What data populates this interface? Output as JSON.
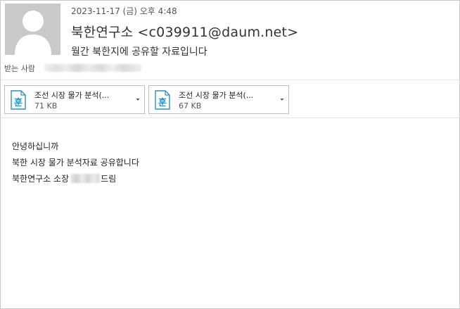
{
  "message": {
    "date": "2023-11-17 (금) 오후 4:48",
    "sender_name": "북한연구소",
    "sender_email": "<c039911@daum.net>",
    "subject": "월간 북한지에 공유할 자료입니다"
  },
  "recipients": {
    "label": "받는 사람"
  },
  "attachments": [
    {
      "name": "조선 시장 물가 분석(...",
      "size": "71 KB",
      "icon": "hwp-file-icon"
    },
    {
      "name": "조선 시장 물가 분석(...",
      "size": "67 KB",
      "icon": "hwp-file-icon"
    }
  ],
  "body": {
    "line1": "안녕하십니까",
    "line2": "북한 시장 물가 분석자료 공유합니다",
    "line3_prefix": "북한연구소 소장",
    "line3_suffix": "드림"
  },
  "colors": {
    "file_icon_blue": "#2a8fc7",
    "avatar_bg": "#c9c9c9"
  }
}
